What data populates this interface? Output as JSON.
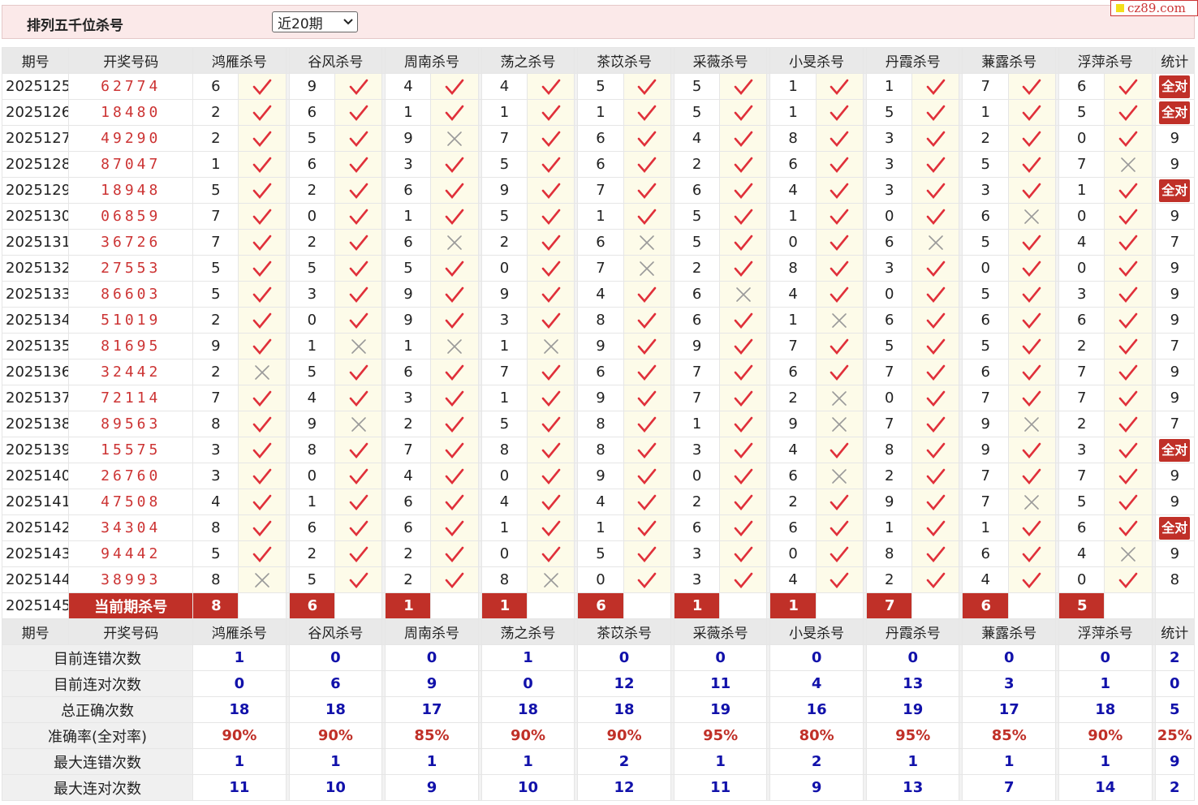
{
  "header": {
    "title": "排列五千位杀号",
    "period_select": "近20期"
  },
  "watermark": "cz89.com",
  "colors": {
    "accent": "#c03028",
    "stat_blue": "#1111aa",
    "check": "#e0303a",
    "cross": "#9a9a9a"
  },
  "columns": {
    "issue": "期号",
    "draw": "开奖号码",
    "experts": [
      "鸿雁杀号",
      "谷风杀号",
      "周南杀号",
      "荡之杀号",
      "茶苡杀号",
      "采薇杀号",
      "小旻杀号",
      "丹霞杀号",
      "蒹露杀号",
      "浮萍杀号"
    ],
    "stat": "统计"
  },
  "rows": [
    {
      "issue": "2025125",
      "draw": "62774",
      "kills": [
        6,
        9,
        4,
        4,
        5,
        5,
        1,
        1,
        7,
        6
      ],
      "ok": [
        1,
        1,
        1,
        1,
        1,
        1,
        1,
        1,
        1,
        1
      ],
      "stat": "全对"
    },
    {
      "issue": "2025126",
      "draw": "18480",
      "kills": [
        2,
        6,
        1,
        1,
        1,
        5,
        1,
        5,
        1,
        5
      ],
      "ok": [
        1,
        1,
        1,
        1,
        1,
        1,
        1,
        1,
        1,
        1
      ],
      "stat": "全对"
    },
    {
      "issue": "2025127",
      "draw": "49290",
      "kills": [
        2,
        5,
        9,
        7,
        6,
        4,
        8,
        3,
        2,
        0
      ],
      "ok": [
        1,
        1,
        0,
        1,
        1,
        1,
        1,
        1,
        1,
        1
      ],
      "stat": "9"
    },
    {
      "issue": "2025128",
      "draw": "87047",
      "kills": [
        1,
        6,
        3,
        5,
        6,
        2,
        6,
        3,
        5,
        7
      ],
      "ok": [
        1,
        1,
        1,
        1,
        1,
        1,
        1,
        1,
        1,
        0
      ],
      "stat": "9"
    },
    {
      "issue": "2025129",
      "draw": "18948",
      "kills": [
        5,
        2,
        6,
        9,
        7,
        6,
        4,
        3,
        3,
        1
      ],
      "ok": [
        1,
        1,
        1,
        1,
        1,
        1,
        1,
        1,
        1,
        1
      ],
      "stat": "全对"
    },
    {
      "issue": "2025130",
      "draw": "06859",
      "kills": [
        7,
        0,
        1,
        5,
        1,
        5,
        1,
        0,
        6,
        0
      ],
      "ok": [
        1,
        1,
        1,
        1,
        1,
        1,
        1,
        1,
        0,
        1
      ],
      "stat": "9"
    },
    {
      "issue": "2025131",
      "draw": "36726",
      "kills": [
        7,
        2,
        6,
        2,
        6,
        5,
        0,
        6,
        5,
        4
      ],
      "ok": [
        1,
        1,
        0,
        1,
        0,
        1,
        1,
        0,
        1,
        1
      ],
      "stat": "7"
    },
    {
      "issue": "2025132",
      "draw": "27553",
      "kills": [
        5,
        5,
        5,
        0,
        7,
        2,
        8,
        3,
        0,
        0
      ],
      "ok": [
        1,
        1,
        1,
        1,
        0,
        1,
        1,
        1,
        1,
        1
      ],
      "stat": "9"
    },
    {
      "issue": "2025133",
      "draw": "86603",
      "kills": [
        5,
        3,
        9,
        9,
        4,
        6,
        4,
        0,
        5,
        3
      ],
      "ok": [
        1,
        1,
        1,
        1,
        1,
        0,
        1,
        1,
        1,
        1
      ],
      "stat": "9"
    },
    {
      "issue": "2025134",
      "draw": "51019",
      "kills": [
        2,
        0,
        9,
        3,
        8,
        6,
        1,
        6,
        6,
        6
      ],
      "ok": [
        1,
        1,
        1,
        1,
        1,
        1,
        0,
        1,
        1,
        1
      ],
      "stat": "9"
    },
    {
      "issue": "2025135",
      "draw": "81695",
      "kills": [
        9,
        1,
        1,
        1,
        9,
        9,
        7,
        5,
        5,
        2
      ],
      "ok": [
        1,
        0,
        0,
        0,
        1,
        1,
        1,
        1,
        1,
        1
      ],
      "stat": "7"
    },
    {
      "issue": "2025136",
      "draw": "32442",
      "kills": [
        2,
        5,
        6,
        7,
        6,
        7,
        6,
        7,
        6,
        7
      ],
      "ok": [
        0,
        1,
        1,
        1,
        1,
        1,
        1,
        1,
        1,
        1
      ],
      "stat": "9"
    },
    {
      "issue": "2025137",
      "draw": "72114",
      "kills": [
        7,
        4,
        3,
        1,
        9,
        7,
        2,
        0,
        7,
        7
      ],
      "ok": [
        1,
        1,
        1,
        1,
        1,
        1,
        0,
        1,
        1,
        1
      ],
      "stat": "9"
    },
    {
      "issue": "2025138",
      "draw": "89563",
      "kills": [
        8,
        9,
        2,
        5,
        8,
        1,
        9,
        7,
        9,
        2
      ],
      "ok": [
        1,
        0,
        1,
        1,
        1,
        1,
        0,
        1,
        0,
        1
      ],
      "stat": "7"
    },
    {
      "issue": "2025139",
      "draw": "15575",
      "kills": [
        3,
        8,
        7,
        8,
        8,
        3,
        4,
        8,
        9,
        3
      ],
      "ok": [
        1,
        1,
        1,
        1,
        1,
        1,
        1,
        1,
        1,
        1
      ],
      "stat": "全对"
    },
    {
      "issue": "2025140",
      "draw": "26760",
      "kills": [
        3,
        0,
        4,
        0,
        9,
        0,
        6,
        2,
        7,
        7
      ],
      "ok": [
        1,
        1,
        1,
        1,
        1,
        1,
        0,
        1,
        1,
        1
      ],
      "stat": "9"
    },
    {
      "issue": "2025141",
      "draw": "47508",
      "kills": [
        4,
        1,
        6,
        4,
        4,
        2,
        2,
        9,
        7,
        5
      ],
      "ok": [
        1,
        1,
        1,
        1,
        1,
        1,
        1,
        1,
        0,
        1
      ],
      "stat": "9"
    },
    {
      "issue": "2025142",
      "draw": "34304",
      "kills": [
        8,
        6,
        6,
        1,
        1,
        6,
        6,
        1,
        1,
        6
      ],
      "ok": [
        1,
        1,
        1,
        1,
        1,
        1,
        1,
        1,
        1,
        1
      ],
      "stat": "全对"
    },
    {
      "issue": "2025143",
      "draw": "94442",
      "kills": [
        5,
        2,
        2,
        0,
        5,
        3,
        0,
        8,
        6,
        4
      ],
      "ok": [
        1,
        1,
        1,
        1,
        1,
        1,
        1,
        1,
        1,
        0
      ],
      "stat": "9"
    },
    {
      "issue": "2025144",
      "draw": "38993",
      "kills": [
        8,
        5,
        2,
        8,
        0,
        3,
        4,
        2,
        4,
        0
      ],
      "ok": [
        0,
        1,
        1,
        0,
        1,
        1,
        1,
        1,
        1,
        1
      ],
      "stat": "8"
    }
  ],
  "current": {
    "issue": "2025145",
    "label": "当前期杀号",
    "kills": [
      8,
      6,
      1,
      1,
      6,
      1,
      1,
      7,
      6,
      5
    ]
  },
  "stats": [
    {
      "label": "目前连错次数",
      "values": [
        "1",
        "0",
        "0",
        "1",
        "0",
        "0",
        "0",
        "0",
        "0",
        "0"
      ],
      "total": "2"
    },
    {
      "label": "目前连对次数",
      "values": [
        "0",
        "6",
        "9",
        "0",
        "12",
        "11",
        "4",
        "13",
        "3",
        "1"
      ],
      "total": "0"
    },
    {
      "label": "总正确次数",
      "values": [
        "18",
        "18",
        "17",
        "18",
        "18",
        "19",
        "16",
        "19",
        "17",
        "18"
      ],
      "total": "5"
    },
    {
      "label": "准确率(全对率)",
      "values": [
        "90%",
        "90%",
        "85%",
        "90%",
        "90%",
        "95%",
        "80%",
        "95%",
        "85%",
        "90%"
      ],
      "total": "25%",
      "pct": true
    },
    {
      "label": "最大连错次数",
      "values": [
        "1",
        "1",
        "1",
        "1",
        "2",
        "1",
        "2",
        "1",
        "1",
        "1"
      ],
      "total": "9"
    },
    {
      "label": "最大连对次数",
      "values": [
        "11",
        "10",
        "9",
        "10",
        "12",
        "11",
        "9",
        "13",
        "7",
        "14"
      ],
      "total": "2"
    }
  ]
}
